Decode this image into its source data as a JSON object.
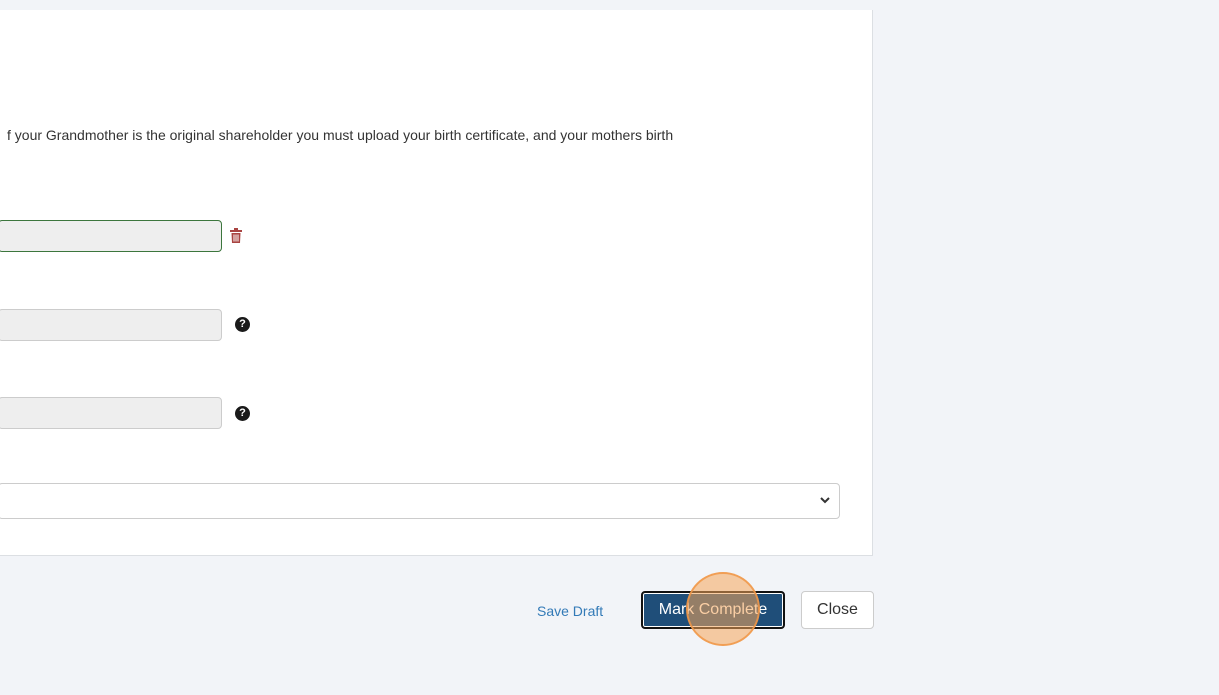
{
  "form": {
    "instruction_text": "f your Grandmother is the original shareholder you must upload your birth certificate, and your mothers birth",
    "uploaded_file_value": "",
    "field_2_value": "",
    "field_3_value": "",
    "select_value": "",
    "help_glyph": "?"
  },
  "footer": {
    "save_draft_label": "Save Draft",
    "mark_complete_label": "Mark Complete",
    "close_label": "Close"
  },
  "colors": {
    "page_background": "#f2f4f8",
    "primary_button": "#1f4e79",
    "link": "#337ab7",
    "delete_icon": "#a94442",
    "valid_border": "#3c763d",
    "click_marker": "#f5a65a"
  },
  "icons": [
    "trash-icon",
    "question-circle-icon",
    "chevron-down-icon"
  ]
}
